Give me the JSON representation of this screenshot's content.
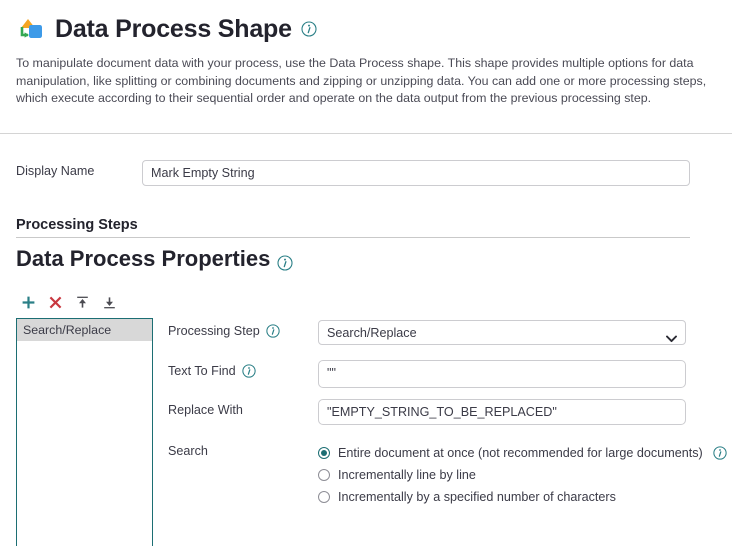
{
  "header": {
    "icon_name": "data-process-shape-icon",
    "title": "Data Process Shape",
    "info_icon": "info-icon",
    "description": "To manipulate document data with your process, use the Data Process shape. This shape provides multiple options for data manipulation, like splitting or combining documents and zipping or unzipping data. You can add one or more processing steps, which execute according to their sequential order and operate on the data output from the previous processing step."
  },
  "display_name": {
    "label": "Display Name",
    "value": "Mark Empty String",
    "placeholder": ""
  },
  "processing_steps": {
    "section_label": "Processing Steps",
    "panel_title": "Data Process Properties",
    "toolbar": [
      {
        "name": "add-step-button",
        "glyph": "plus",
        "color": "#2a7f86"
      },
      {
        "name": "delete-step-button",
        "glyph": "cross",
        "color": "#c8373f"
      },
      {
        "name": "move-step-up-button",
        "glyph": "arrow-up-to-bar",
        "color": "#4b4b52"
      },
      {
        "name": "move-step-down-button",
        "glyph": "arrow-down-to-bar",
        "color": "#4b4b52"
      }
    ],
    "steps_list": [
      {
        "label": "Search/Replace",
        "selected": true
      }
    ]
  },
  "properties": {
    "processing_step": {
      "label": "Processing Step",
      "value": "Search/Replace",
      "options": [
        "Search/Replace"
      ]
    },
    "text_to_find": {
      "label": "Text To Find",
      "value": "\"\"",
      "placeholder": ""
    },
    "replace_with": {
      "label": "Replace With",
      "value": "\"EMPTY_STRING_TO_BE_REPLACED\"",
      "placeholder": ""
    },
    "search": {
      "label": "Search",
      "options": [
        {
          "label": "Entire document at once (not recommended for large documents)",
          "selected": true,
          "has_info": true
        },
        {
          "label": "Incrementally line by line",
          "selected": false,
          "has_info": false
        },
        {
          "label": "Incrementally by a specified number of characters",
          "selected": false,
          "has_info": false
        }
      ]
    }
  },
  "colors": {
    "accent_teal": "#1c6e73",
    "icon_orange": "#f5a623",
    "icon_green": "#34a853",
    "icon_blue": "#3d9ae8",
    "delete_red": "#c8373f",
    "text": "#3b3b47"
  }
}
